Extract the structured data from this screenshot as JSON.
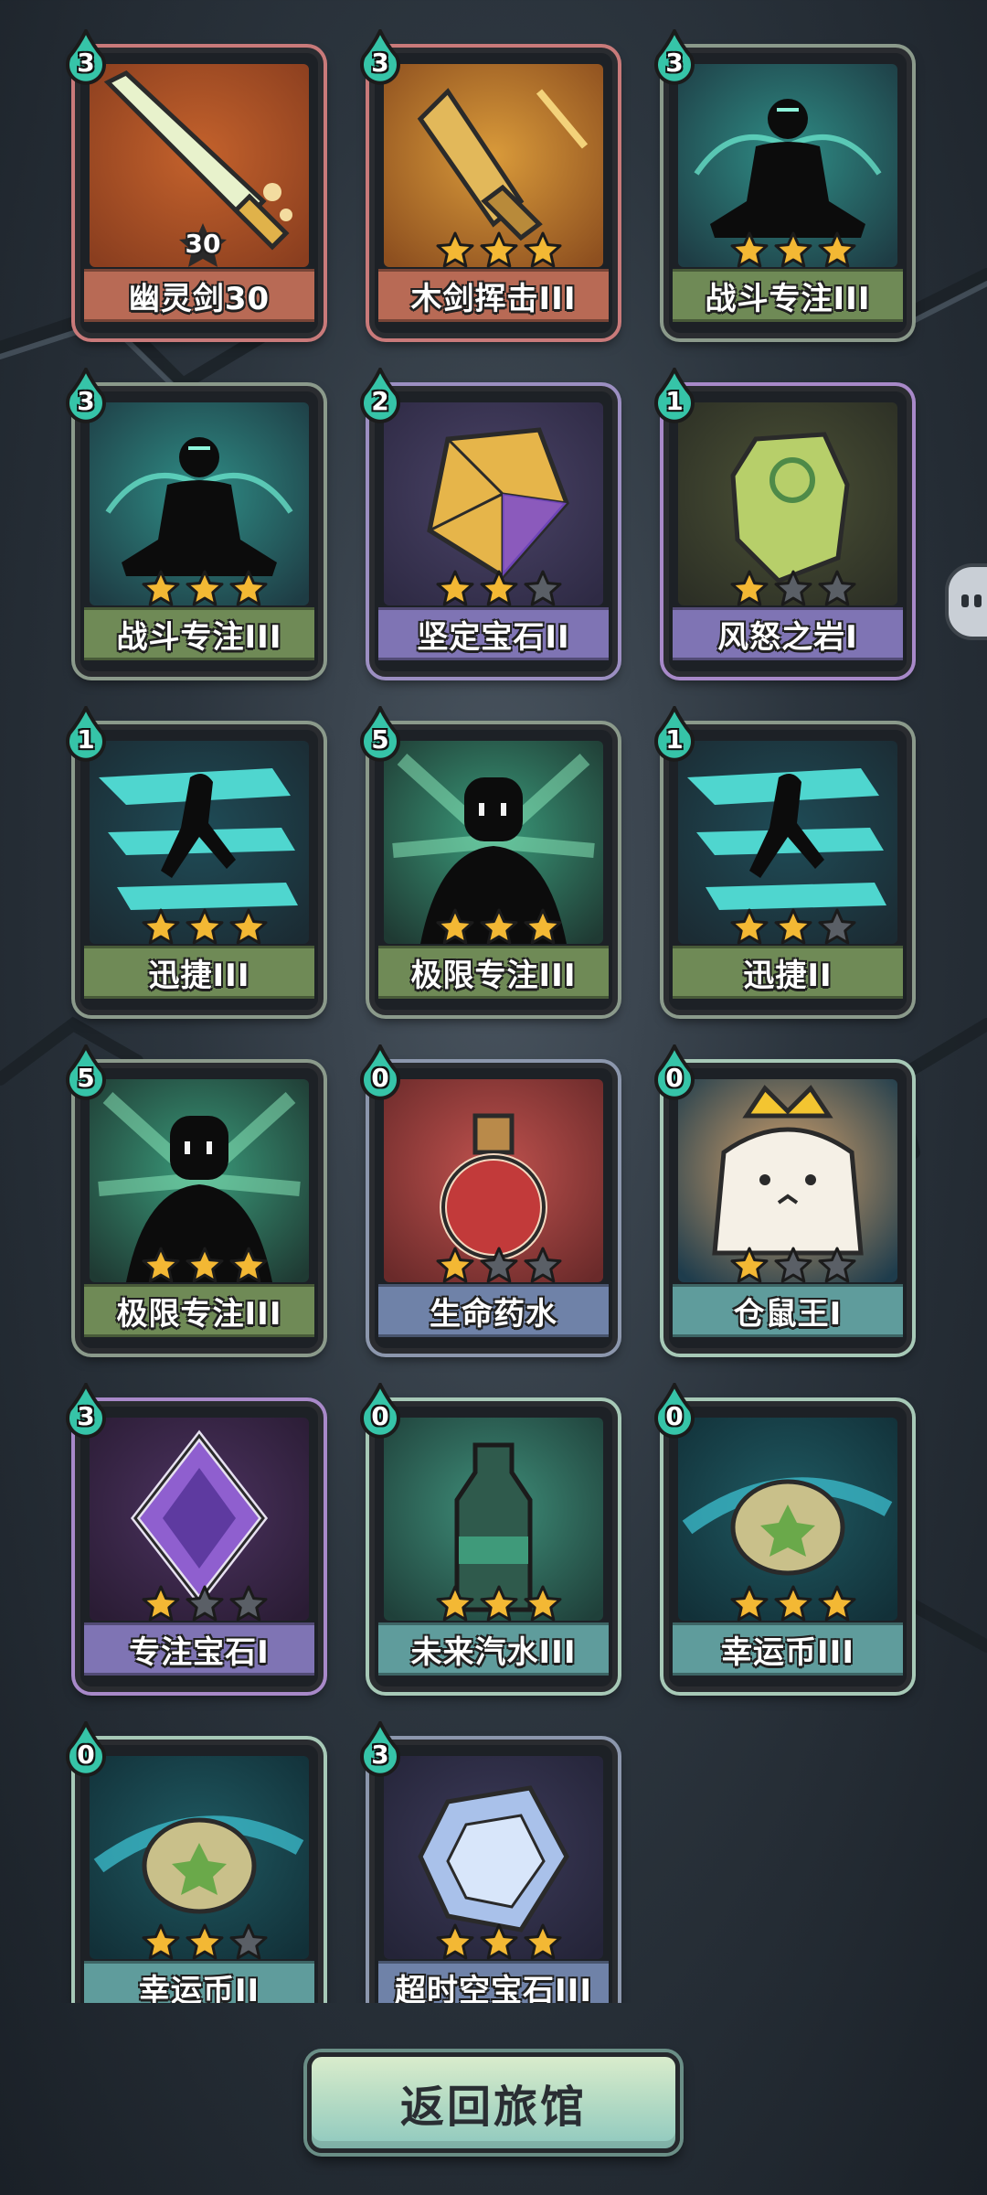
{
  "cards": [
    {
      "name": "幽灵剑30",
      "cost": "3",
      "stars": 0,
      "level_badge": "30",
      "theme": "sword-ghost",
      "rim": "#c97a7a",
      "plate": "#b86a55"
    },
    {
      "name": "木剑挥击III",
      "cost": "3",
      "stars": 3,
      "theme": "sword-wood",
      "rim": "#c97a7a",
      "plate": "#b86a55"
    },
    {
      "name": "战斗专注III",
      "cost": "3",
      "stars": 3,
      "theme": "meditate",
      "rim": "#8b9a8b",
      "plate": "#6f8a56"
    },
    {
      "name": "战斗专注III",
      "cost": "3",
      "stars": 3,
      "theme": "meditate",
      "rim": "#8b9a8b",
      "plate": "#6f8a56"
    },
    {
      "name": "坚定宝石II",
      "cost": "2",
      "stars": 2,
      "theme": "gem-gold",
      "rim": "#9c8fc2",
      "plate": "#7f74b4"
    },
    {
      "name": "风怒之岩I",
      "cost": "1",
      "stars": 1,
      "theme": "rock-green",
      "rim": "#a889c9",
      "plate": "#7f74b4"
    },
    {
      "name": "迅捷III",
      "cost": "1",
      "stars": 3,
      "theme": "swift",
      "rim": "#8b9a8b",
      "plate": "#6f8a56"
    },
    {
      "name": "极限专注III",
      "cost": "5",
      "stars": 3,
      "theme": "limit",
      "rim": "#8b9a8b",
      "plate": "#6f8a56"
    },
    {
      "name": "迅捷II",
      "cost": "1",
      "stars": 2,
      "theme": "swift",
      "rim": "#8b9a8b",
      "plate": "#6f8a56"
    },
    {
      "name": "极限专注III",
      "cost": "5",
      "stars": 3,
      "theme": "limit",
      "rim": "#8b9a8b",
      "plate": "#6f8a56"
    },
    {
      "name": "生命药水",
      "cost": "0",
      "stars": 1,
      "theme": "potion",
      "rim": "#8c97ad",
      "plate": "#6f82a8"
    },
    {
      "name": "仓鼠王I",
      "cost": "0",
      "stars": 1,
      "theme": "hamster",
      "rim": "#a7c9b7",
      "plate": "#5f9c9c"
    },
    {
      "name": "专注宝石I",
      "cost": "3",
      "stars": 1,
      "theme": "gem-purple",
      "rim": "#a889c9",
      "plate": "#7f74b4"
    },
    {
      "name": "未来汽水III",
      "cost": "0",
      "stars": 3,
      "theme": "soda",
      "rim": "#a7c9b7",
      "plate": "#5f9c9c"
    },
    {
      "name": "幸运币III",
      "cost": "0",
      "stars": 3,
      "theme": "coin",
      "rim": "#a7c9b7",
      "plate": "#5f9c9c"
    },
    {
      "name": "幸运币II",
      "cost": "0",
      "stars": 2,
      "theme": "coin",
      "rim": "#a7c9b7",
      "plate": "#5f9c9c"
    },
    {
      "name": "超时空宝石III",
      "cost": "3",
      "stars": 3,
      "theme": "gem-blue",
      "rim": "#8c97ad",
      "plate": "#6f82a8"
    }
  ],
  "back_button": {
    "label": "返回旅馆"
  },
  "colors": {
    "star_on": "#f3b834",
    "star_off": "#5a5f66",
    "cost_drop": "#36c4a8"
  }
}
